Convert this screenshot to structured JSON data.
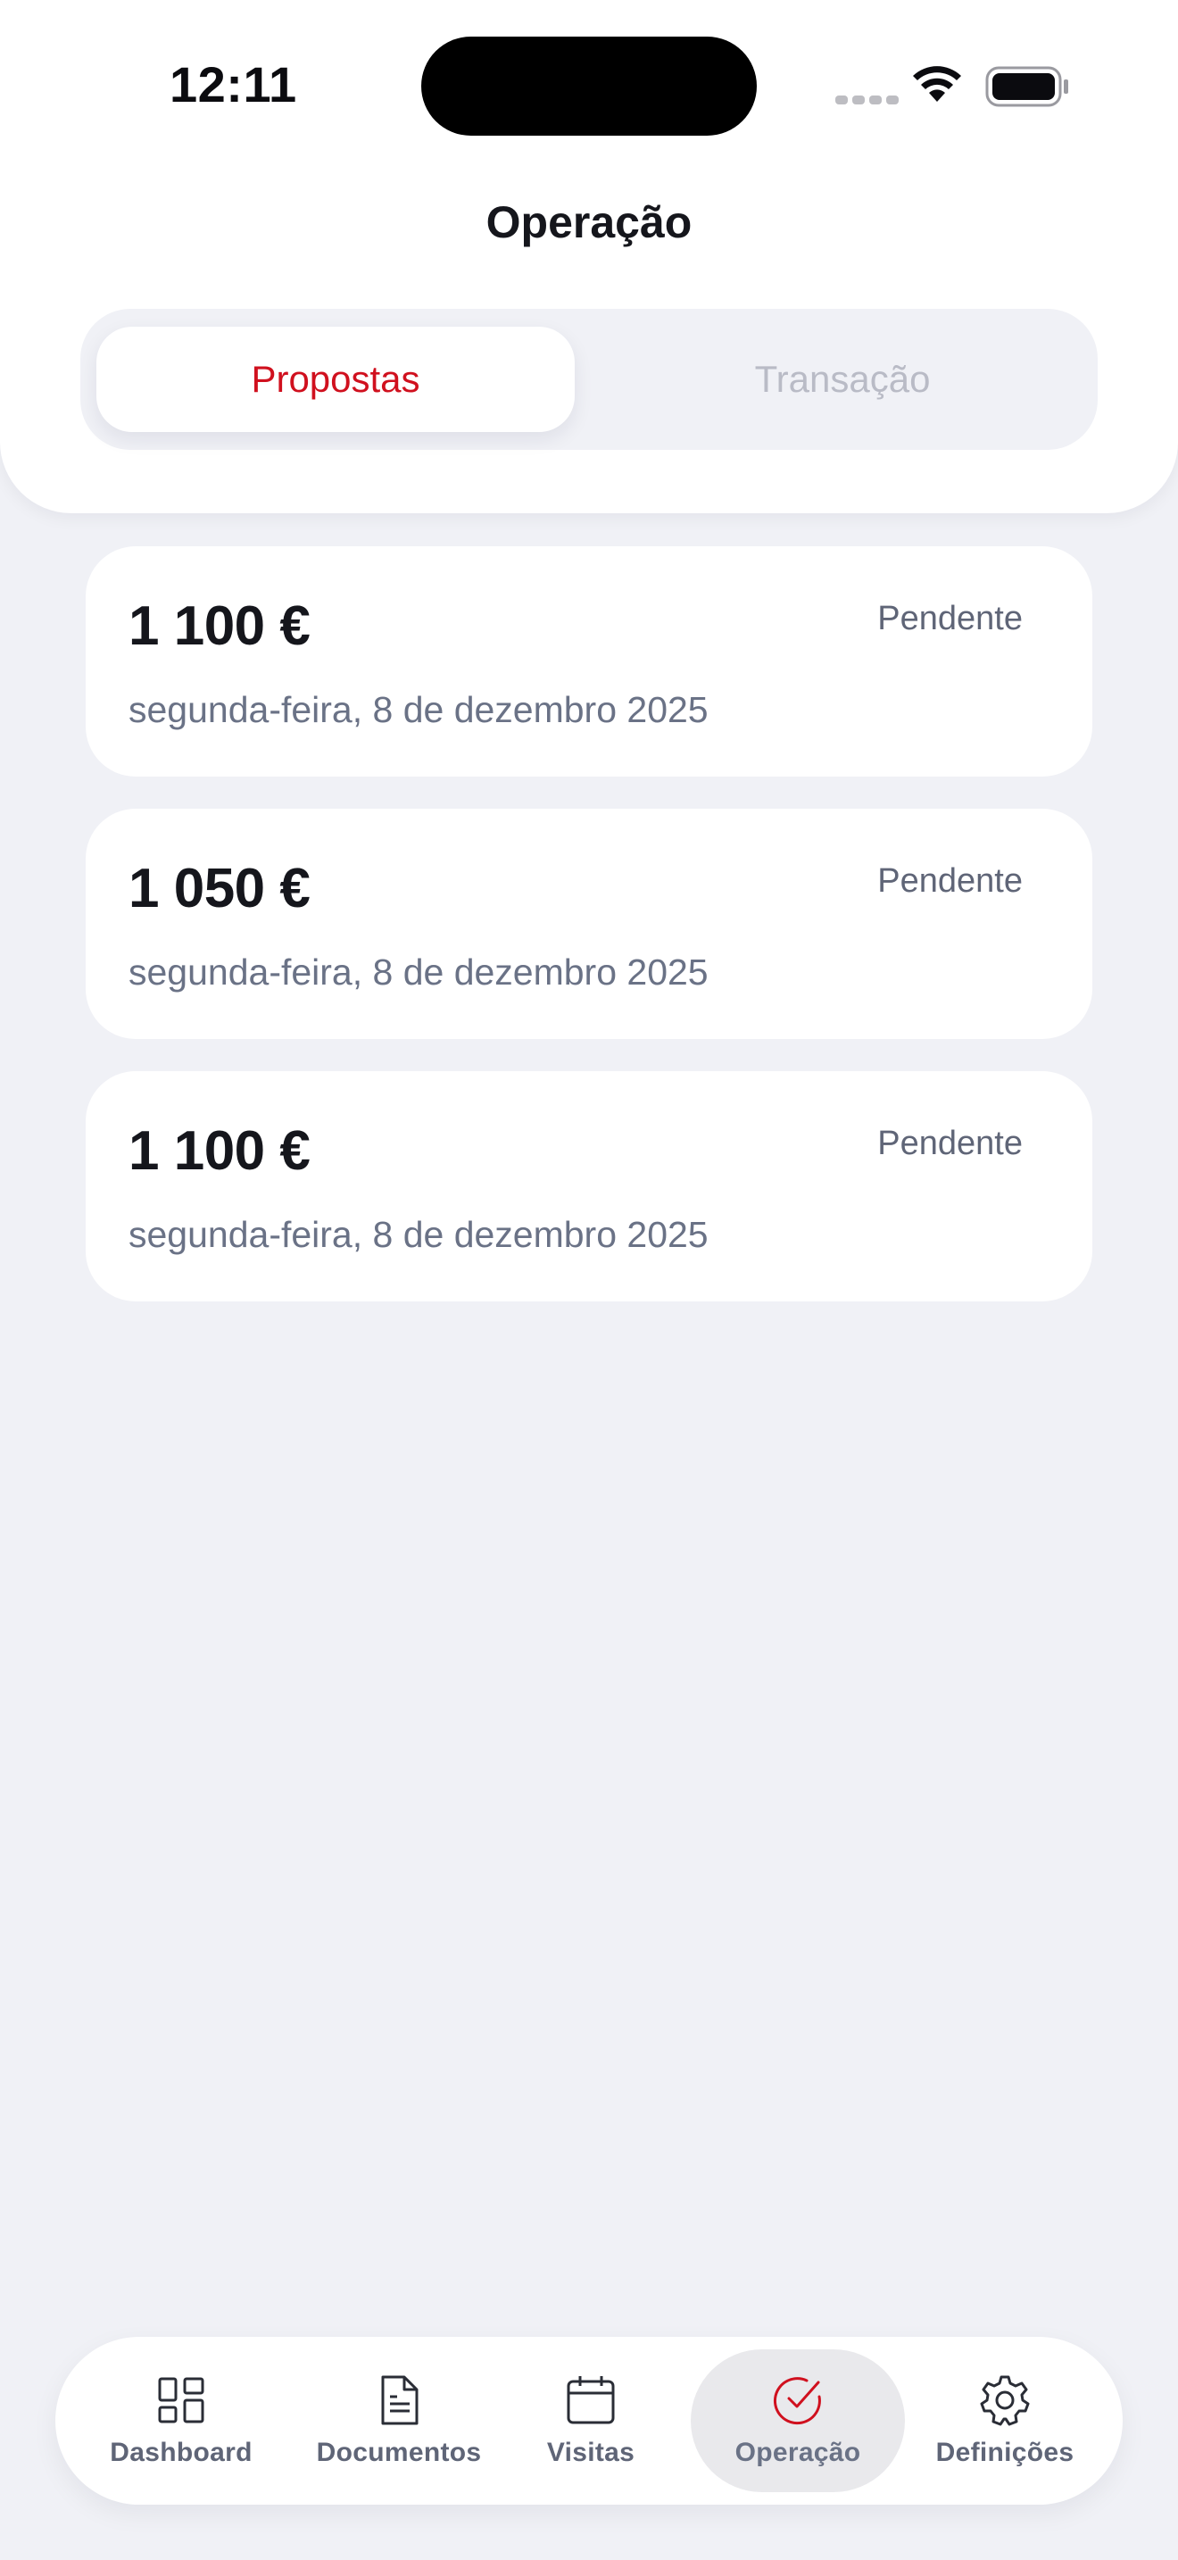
{
  "status_bar": {
    "time": "12:11"
  },
  "header": {
    "title": "Operação"
  },
  "segmented": {
    "tabs": [
      {
        "label": "Propostas",
        "selected": true
      },
      {
        "label": "Transação",
        "selected": false
      }
    ]
  },
  "proposals": [
    {
      "amount": "1 100 €",
      "status": "Pendente",
      "date": "segunda-feira, 8 de dezembro 2025"
    },
    {
      "amount": "1 050 €",
      "status": "Pendente",
      "date": "segunda-feira, 8 de dezembro 2025"
    },
    {
      "amount": "1 100 €",
      "status": "Pendente",
      "date": "segunda-feira, 8 de dezembro 2025"
    }
  ],
  "bottom_nav": {
    "items": [
      {
        "label": "Dashboard",
        "icon": "dashboard-icon"
      },
      {
        "label": "Documentos",
        "icon": "document-icon"
      },
      {
        "label": "Visitas",
        "icon": "calendar-icon"
      },
      {
        "label": "Operação",
        "icon": "check-circle-icon",
        "selected": true
      },
      {
        "label": "Definições",
        "icon": "gear-icon"
      }
    ]
  },
  "colors": {
    "accent": "#d0101e",
    "background": "#f0f1f6",
    "card": "#ffffff",
    "muted_text": "#6a7286"
  }
}
